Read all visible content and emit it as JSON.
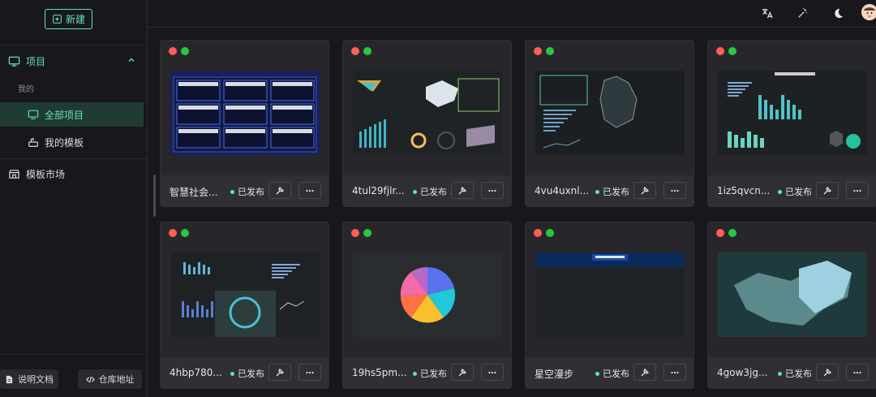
{
  "sidebar": {
    "new_label": "新建",
    "project_label": "项目",
    "group_label": "我的",
    "all_projects_label": "全部项目",
    "my_templates_label": "我的模板",
    "template_market_label": "模板市场",
    "docs_label": "说明文档",
    "repo_label": "仓库地址"
  },
  "topbar": {
    "icons": [
      "translate-icon",
      "magic-wand-icon",
      "moon-icon",
      "avatar"
    ]
  },
  "accent_color": "#63e2b7",
  "cards": [
    {
      "name": "智慧社会...",
      "status": "已发布"
    },
    {
      "name": "4tul29fjlr...",
      "status": "已发布"
    },
    {
      "name": "4vu4uxnl...",
      "status": "已发布"
    },
    {
      "name": "1iz5qvcn...",
      "status": "已发布"
    },
    {
      "name": "4hbp780...",
      "status": "已发布"
    },
    {
      "name": "19hs5pm...",
      "status": "已发布"
    },
    {
      "name": "星空漫步",
      "status": "已发布"
    },
    {
      "name": "4gow3jg...",
      "status": "已发布"
    }
  ]
}
